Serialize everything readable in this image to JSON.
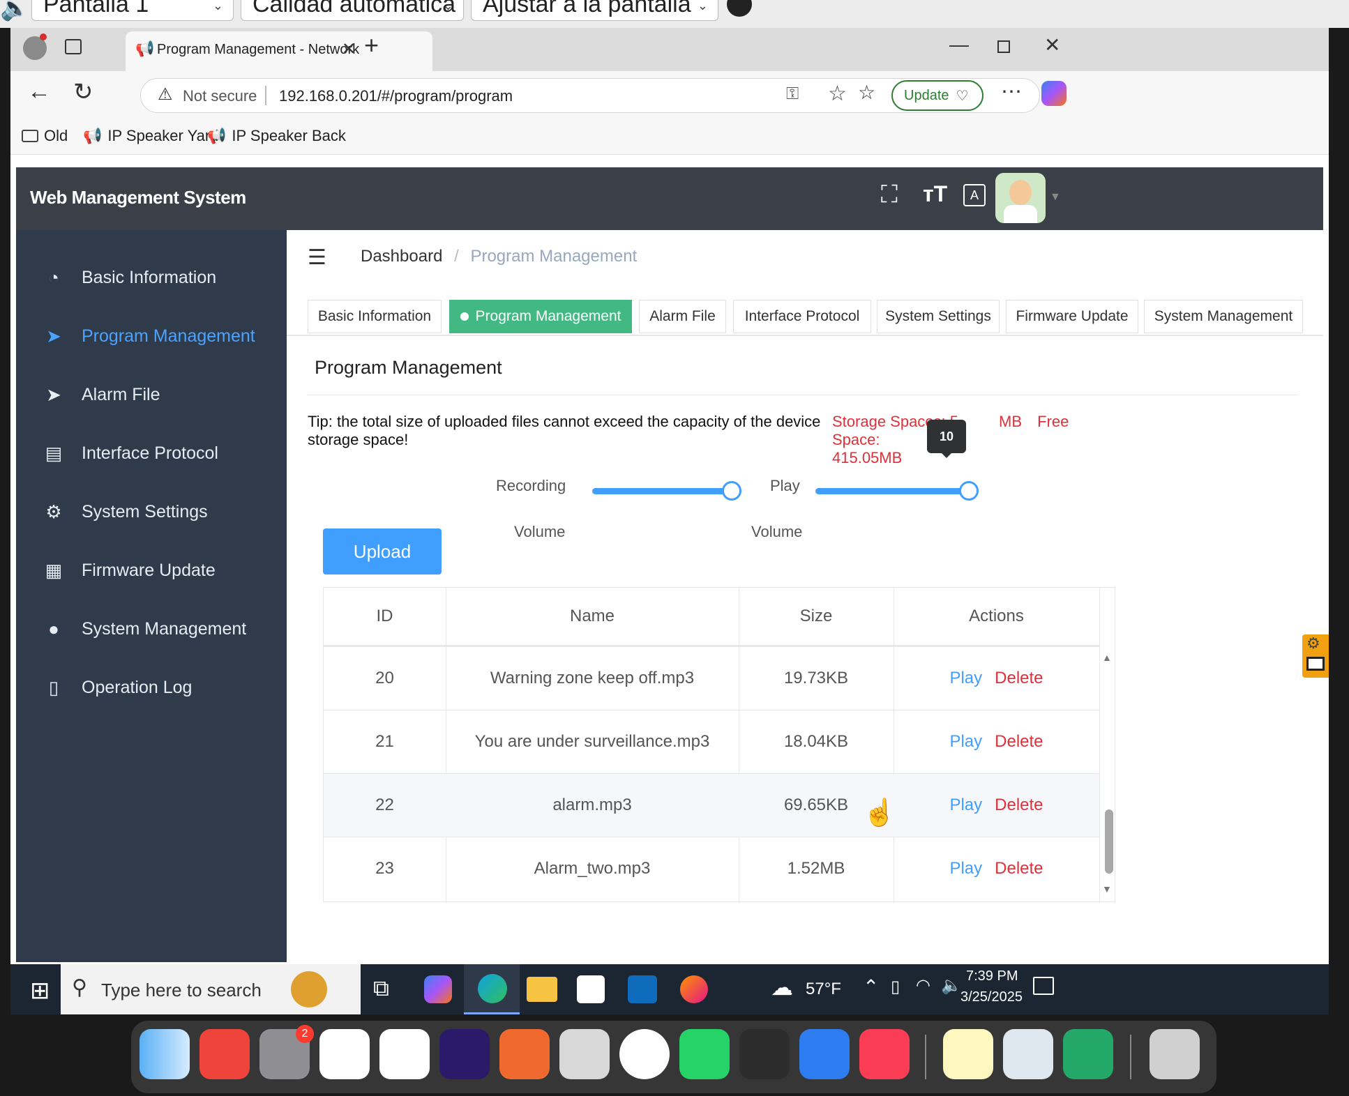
{
  "viewer": {
    "display_select": "Pantalla 1",
    "quality_select": "Calidad automática",
    "fit_select": "Ajustar a la pantalla"
  },
  "browser": {
    "tab_title": "Program Management - Network",
    "address_warning": "Not secure",
    "address_url": "192.168.0.201/#/program/program",
    "update_label": "Update",
    "bookmarks": [
      "Old",
      "IP Speaker Yard",
      "IP Speaker Back"
    ]
  },
  "app": {
    "title": "Web Management System",
    "sidebar": [
      {
        "label": "Basic Information",
        "icon": "dashboard-icon"
      },
      {
        "label": "Program Management",
        "icon": "send-icon"
      },
      {
        "label": "Alarm File",
        "icon": "send-icon"
      },
      {
        "label": "Interface Protocol",
        "icon": "document-icon"
      },
      {
        "label": "System Settings",
        "icon": "gear-icon"
      },
      {
        "label": "Firmware Update",
        "icon": "grid-icon"
      },
      {
        "label": "System Management",
        "icon": "globe-icon"
      },
      {
        "label": "Operation Log",
        "icon": "log-icon"
      }
    ],
    "breadcrumb": {
      "home": "Dashboard",
      "sep": "/",
      "current": "Program Management"
    },
    "tabs": [
      "Basic Information",
      "Program Management",
      "Alarm File",
      "Interface Protocol",
      "System Settings",
      "Firmware Update",
      "System Management"
    ],
    "page_title": "Program Management",
    "tip": "Tip: the total size of uploaded files cannot exceed the capacity of the device storage space!",
    "storage_label": "Storage Spaces: 5",
    "storage_suffix": "MB",
    "free_space_label": "Free Space:",
    "free_space_value": "415.05MB",
    "tooltip_value": "10",
    "upload_label": "Upload",
    "recording_label": "Recording",
    "recording_volume_label": "Volume",
    "play_label": "Play",
    "play_volume_label": "Volume",
    "recording_volume_fraction": 1.0,
    "play_volume_fraction": 1.0,
    "table": {
      "headers": [
        "ID",
        "Name",
        "Size",
        "Actions"
      ],
      "rows": [
        {
          "id": "20",
          "name": "Warning zone keep off.mp3",
          "size": "19.73KB",
          "play": "Play",
          "delete": "Delete"
        },
        {
          "id": "21",
          "name": "You are under surveillance.mp3",
          "size": "18.04KB",
          "play": "Play",
          "delete": "Delete"
        },
        {
          "id": "22",
          "name": "alarm.mp3",
          "size": "69.65KB",
          "play": "Play",
          "delete": "Delete"
        },
        {
          "id": "23",
          "name": "Alarm_two.mp3",
          "size": "1.52MB",
          "play": "Play",
          "delete": "Delete"
        }
      ]
    }
  },
  "taskbar": {
    "search_placeholder": "Type here to search",
    "weather": "57°F",
    "time": "7:39 PM",
    "date": "3/25/2025"
  },
  "dock": {
    "settings_badge": "2"
  },
  "colors": {
    "sidebar_bg": "#2f3a4a",
    "header_bg": "#3a3f48",
    "accent": "#409eff",
    "active_tab": "#42b983",
    "danger": "#e0303a"
  }
}
